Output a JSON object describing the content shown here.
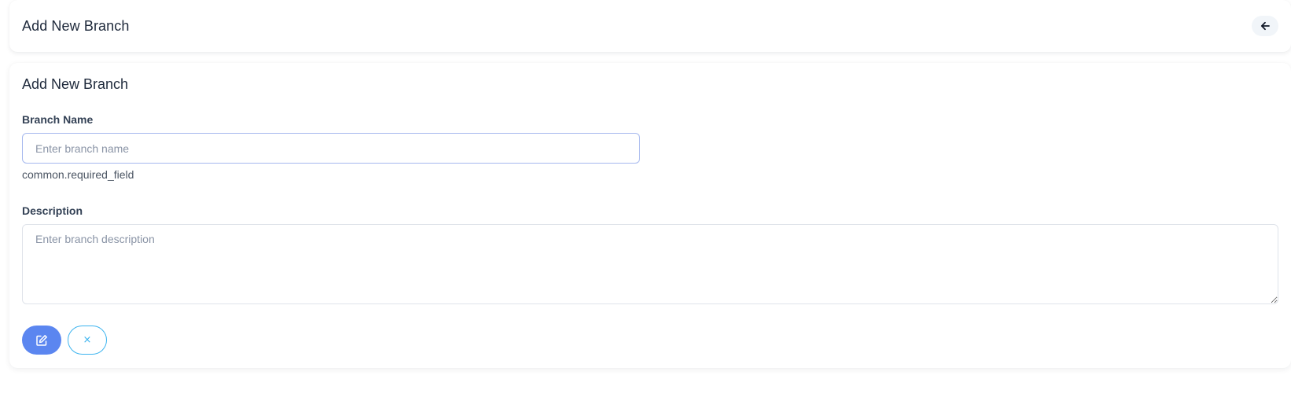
{
  "header": {
    "title": "Add New Branch",
    "back_icon": "arrow-left-icon"
  },
  "form": {
    "title": "Add New Branch",
    "branch_name": {
      "label": "Branch Name",
      "value": "",
      "placeholder": "Enter branch name",
      "helper": "common.required_field"
    },
    "description": {
      "label": "Description",
      "value": "",
      "placeholder": "Enter branch description"
    },
    "actions": {
      "submit_icon": "edit-icon",
      "cancel_icon": "close-icon",
      "cancel_glyph": "×"
    }
  },
  "colors": {
    "primary": "#5b86f0",
    "cancel_border": "#3db4ef",
    "input_focus_border": "#a5b8ee"
  }
}
